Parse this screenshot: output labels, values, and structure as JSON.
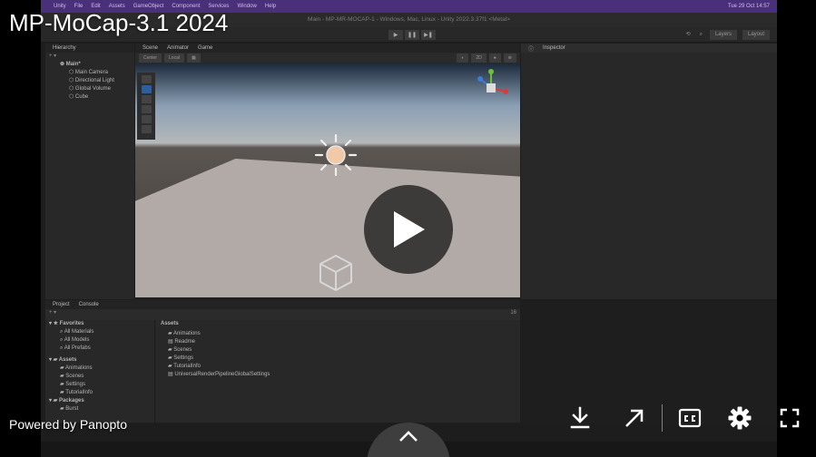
{
  "player": {
    "title": "MP-MoCap-3.1 2024",
    "powered_by": "Powered by Panopto",
    "controls": [
      "download-icon",
      "open-external-icon",
      "closed-captions-icon",
      "gear-icon",
      "fullscreen-icon",
      "chevron-up-icon"
    ],
    "colors": {
      "play_circle": "#3d3a3a",
      "menubar": "#4a2f7a",
      "selection_blue": "#2e5f98"
    }
  },
  "unity": {
    "menubar": {
      "items": [
        "Unity",
        "File",
        "Edit",
        "Assets",
        "GameObject",
        "Component",
        "Services",
        "Window",
        "Help"
      ],
      "clock": "Tue 29 Oct 14:57"
    },
    "window_title": "Main - MP-MR-MOCAP-1 - Windows, Mac, Linux - Unity 2022.3.37f1 <Metal>",
    "toolbar": {
      "layers": "Layers",
      "layout": "Layout"
    },
    "hierarchy": {
      "tab": "Hierarchy",
      "scene": "Main*",
      "items": [
        "Main Camera",
        "Directional Light",
        "Global Volume",
        "Cube"
      ]
    },
    "scene_tabs": [
      "Scene",
      "Animator",
      "Game"
    ],
    "scene_toolbar": {
      "pivot": "Center",
      "space": "Local",
      "mode_2d": "2D"
    },
    "inspector": {
      "tab": "Inspector"
    },
    "project": {
      "tabs": [
        "Project",
        "Console"
      ],
      "favorites": {
        "label": "Favorites",
        "items": [
          "All Materials",
          "All Models",
          "All Prefabs"
        ]
      },
      "assets": {
        "label": "Assets",
        "items": [
          "Animations",
          "Scenes",
          "Settings",
          "TutorialInfo"
        ]
      },
      "packages": {
        "label": "Packages",
        "items": [
          "Burst"
        ]
      },
      "breadcrumb": "Assets",
      "content": [
        "Animations",
        "Readme",
        "Scenes",
        "Settings",
        "TutorialInfo",
        "UniversalRenderPipelineGlobalSettings"
      ],
      "hidden_count": "16"
    }
  }
}
